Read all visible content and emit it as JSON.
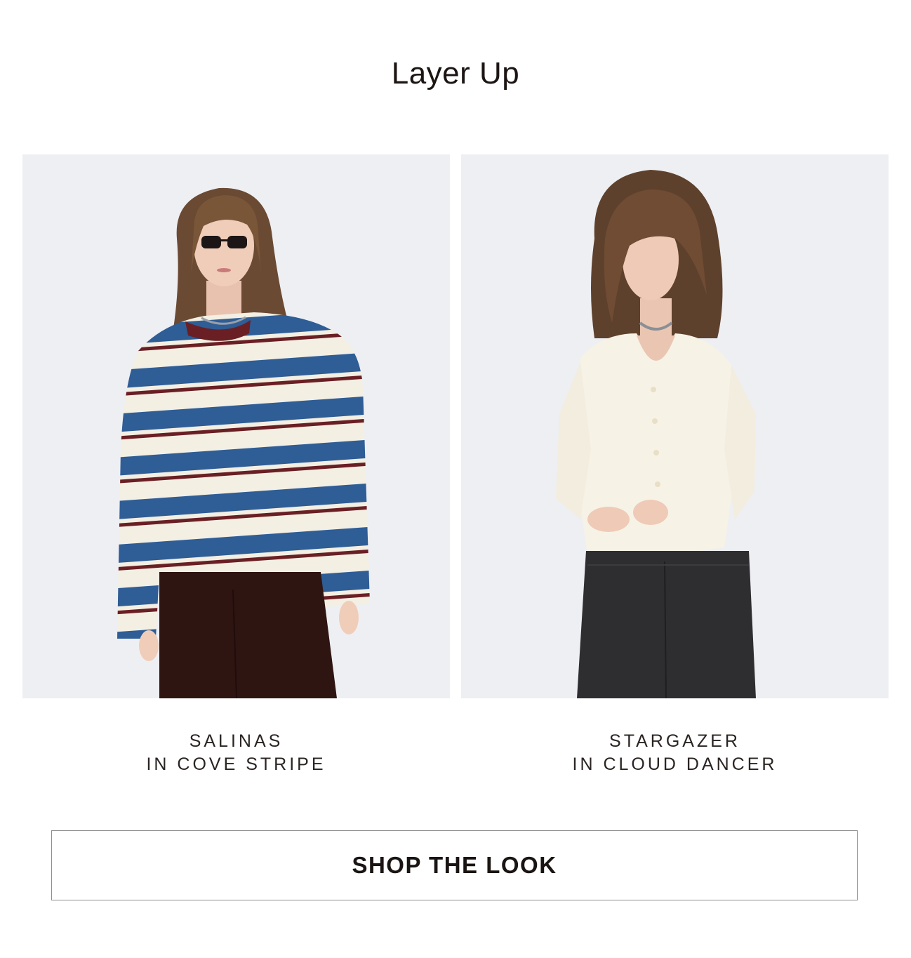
{
  "section": {
    "title": "Layer Up"
  },
  "products": [
    {
      "name": "SALINAS",
      "color_line": "IN COVE STRIPE",
      "stripe_colors": [
        "#2f5d96",
        "#f3efe3",
        "#6a1f24"
      ],
      "pants_color": "#2e1512"
    },
    {
      "name": "STARGAZER",
      "color_line": "IN CLOUD DANCER",
      "top_color": "#f7f2e6",
      "jeans_color": "#2e2e31"
    }
  ],
  "cta": {
    "label": "SHOP THE LOOK"
  },
  "colors": {
    "text": "#1a1412",
    "photo_bg": "#eeeff3",
    "button_border": "#8e8e8e"
  }
}
